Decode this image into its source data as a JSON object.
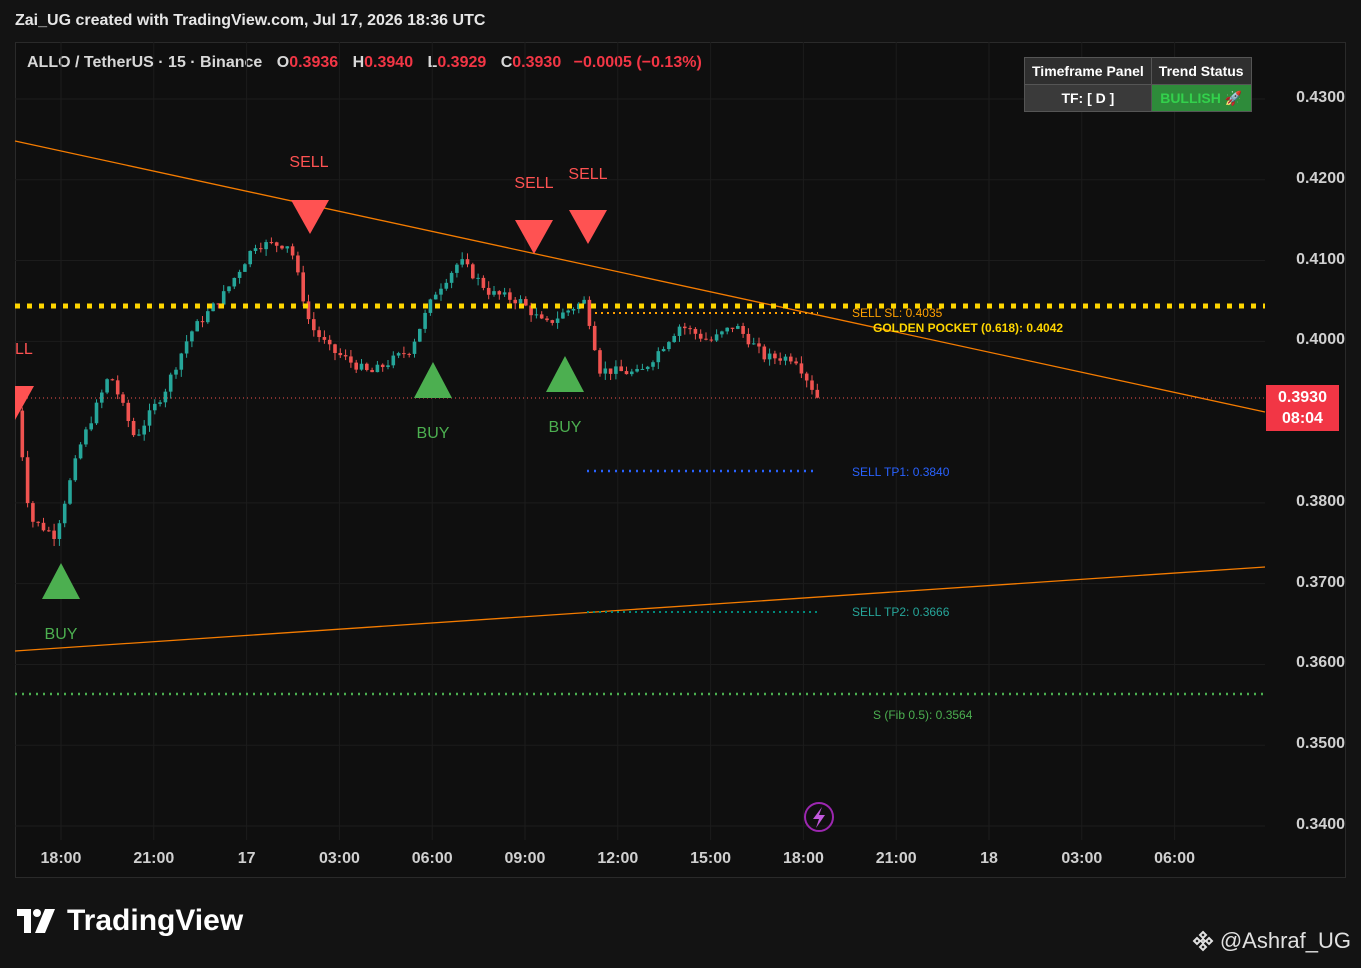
{
  "header": {
    "title": "Zai_UG created with TradingView.com, Jul 17, 2026 18:36 UTC"
  },
  "symbol": {
    "name": "ALLO / TetherUS · 15 · Binance",
    "open_label": "O",
    "open": "0.3936",
    "high_label": "H",
    "high": "0.3940",
    "low_label": "L",
    "low": "0.3929",
    "close_label": "C",
    "close": "0.3930",
    "change": "−0.0005 (−0.13%)"
  },
  "panel": {
    "col1_header": "Timeframe Panel",
    "col2_header": "Trend Status",
    "timeframe": "TF: [ D ]",
    "trend": "BULLISH 🚀"
  },
  "price_axis": {
    "ticks": [
      "0.4300",
      "0.4200",
      "0.4100",
      "0.4000",
      "0.3800",
      "0.3700",
      "0.3600",
      "0.3500",
      "0.3400"
    ],
    "current_price": "0.3930",
    "countdown": "08:04"
  },
  "time_axis": {
    "ticks": [
      "18:00",
      "21:00",
      "17",
      "03:00",
      "06:00",
      "09:00",
      "12:00",
      "15:00",
      "18:00",
      "21:00",
      "18",
      "03:00",
      "06:00"
    ]
  },
  "levels": {
    "sell_sl": "SELL SL: 0.4035",
    "golden_pocket": "GOLDEN POCKET (0.618): 0.4042",
    "tp1": "SELL TP1: 0.3840",
    "tp2": "SELL TP2: 0.3666",
    "fib": "S (Fib 0.5): 0.3564"
  },
  "signals": {
    "sell": "SELL",
    "buy": "BUY",
    "sell_partial": "LL"
  },
  "colors": {
    "up": "#26a69a",
    "down": "#ef5350",
    "sell_marker": "#ff5252",
    "buy_marker": "#4caf50",
    "golden": "#ffd600",
    "trendline": "#f57c00",
    "tp1": "#2962ff",
    "tp2": "#00897b",
    "fib": "#4caf50"
  },
  "brand": {
    "logo": "TradingView"
  },
  "attribution": {
    "text": "@Ashraf_UG"
  },
  "icons": {
    "replay": "lightning-icon",
    "binance": "binance-diamond-icon"
  }
}
